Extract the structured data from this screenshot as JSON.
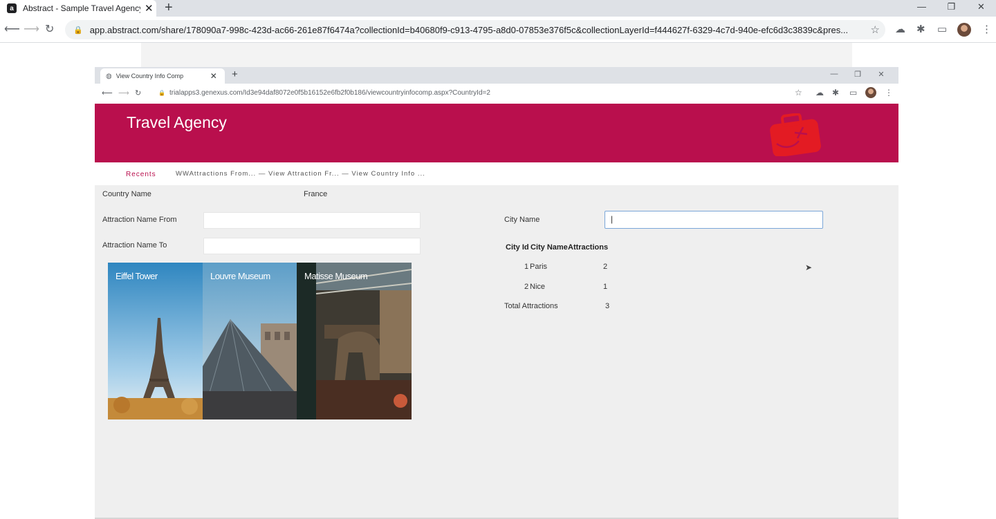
{
  "outer_browser": {
    "tab_title": "Abstract - Sample Travel Agency",
    "tab_close": "✕",
    "new_tab": "+",
    "window_controls": [
      "—",
      "❐",
      "✕"
    ],
    "url": "app.abstract.com/share/178090a7-998c-423d-ac66-261e87f6474a?collectionId=b40680f9-c913-4795-a8d0-07853e376f5c&collectionLayerId=f444627f-6329-4c7d-940e-efc6d3c3839c&pres..."
  },
  "inner_browser": {
    "tab_title": "View Country Info Comp",
    "tab_close": "✕",
    "new_tab": "+",
    "window_controls": [
      "—",
      "❐",
      "✕"
    ],
    "url": "trialapps3.genexus.com/Id3e94daf8072e0f5b16152e6fb2f0b186/viewcountryinfocomp.aspx?CountryId=2"
  },
  "app": {
    "title": "Travel Agency",
    "brand_color": "#b90f4d",
    "recents_label": "Recents",
    "breadcrumbs": "WWAttractions From...  — View Attraction Fr...  — View Country Info ..."
  },
  "form": {
    "country_name_label": "Country Name",
    "country_name_value": "France",
    "attraction_from_label": "Attraction Name From",
    "attraction_from_value": "",
    "attraction_to_label": "Attraction Name To",
    "attraction_to_value": "",
    "city_name_label": "City Name",
    "city_name_value": "|"
  },
  "gallery": [
    {
      "title": "Eiffel Tower"
    },
    {
      "title": "Louvre Museum"
    },
    {
      "title": "Matisse Museum"
    }
  ],
  "city_grid": {
    "headers": [
      "City Id",
      "City Name",
      "Attractions"
    ],
    "rows": [
      {
        "id": "1",
        "name": "Paris",
        "attractions": "2"
      },
      {
        "id": "2",
        "name": "Nice",
        "attractions": "1"
      }
    ],
    "total_label": "Total Attractions",
    "total_value": "3"
  }
}
